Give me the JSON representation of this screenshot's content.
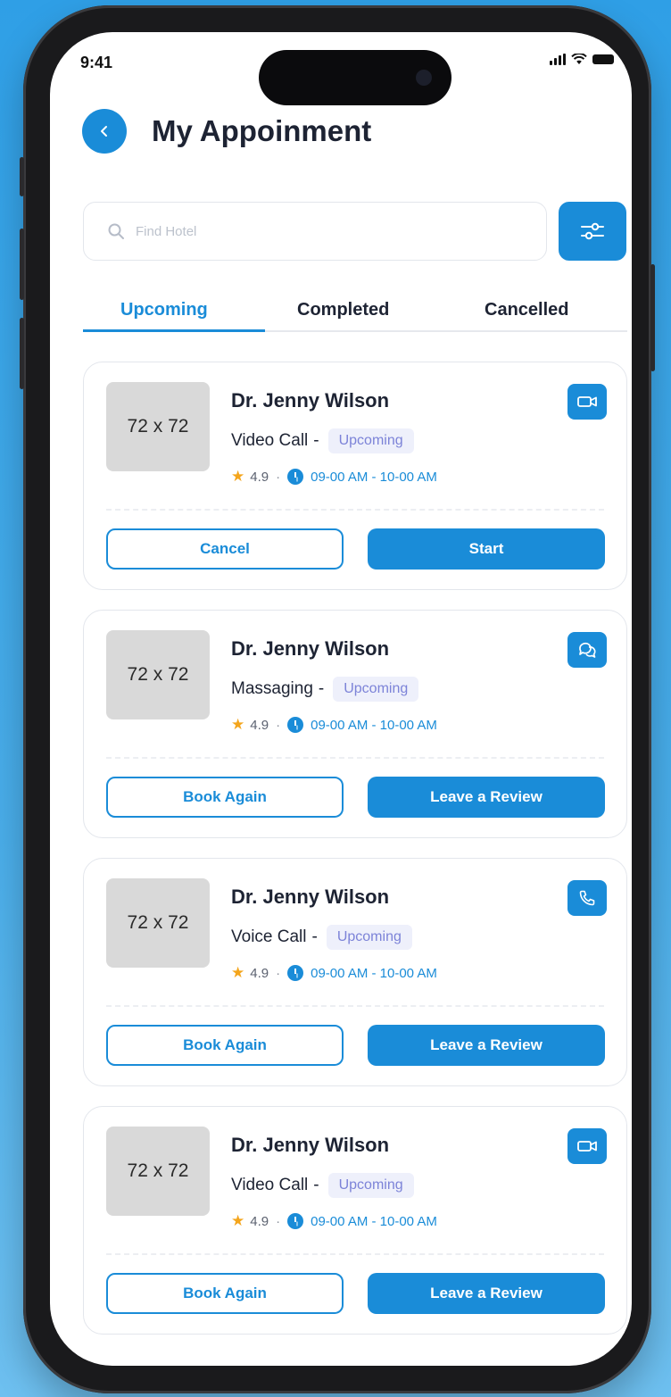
{
  "status_bar": {
    "time": "9:41"
  },
  "header": {
    "title": "My Appoinment"
  },
  "search": {
    "placeholder": "Find Hotel"
  },
  "tabs": [
    {
      "label": "Upcoming",
      "active": true
    },
    {
      "label": "Completed",
      "active": false
    },
    {
      "label": "Cancelled",
      "active": false
    }
  ],
  "appointments": [
    {
      "thumb": "72 x 72",
      "doctor": "Dr. Jenny Wilson",
      "type": "Video Call",
      "separator": "-",
      "status": "Upcoming",
      "rating": "4.9",
      "bullet": "·",
      "time": "09-00 AM - 10-00 AM",
      "mode_icon": "video-icon",
      "secondary_action": "Cancel",
      "primary_action": "Start"
    },
    {
      "thumb": "72 x 72",
      "doctor": "Dr. Jenny Wilson",
      "type": "Massaging",
      "separator": "-",
      "status": "Upcoming",
      "rating": "4.9",
      "bullet": "·",
      "time": "09-00 AM - 10-00 AM",
      "mode_icon": "chat-icon",
      "secondary_action": "Book Again",
      "primary_action": "Leave a Review"
    },
    {
      "thumb": "72 x 72",
      "doctor": "Dr. Jenny Wilson",
      "type": "Voice Call",
      "separator": "-",
      "status": "Upcoming",
      "rating": "4.9",
      "bullet": "·",
      "time": "09-00 AM - 10-00 AM",
      "mode_icon": "phone-icon",
      "secondary_action": "Book Again",
      "primary_action": "Leave a Review"
    },
    {
      "thumb": "72 x 72",
      "doctor": "Dr. Jenny Wilson",
      "type": "Video Call",
      "separator": "-",
      "status": "Upcoming",
      "rating": "4.9",
      "bullet": "·",
      "time": "09-00 AM - 10-00 AM",
      "mode_icon": "video-icon",
      "secondary_action": "Book Again",
      "primary_action": "Leave a Review"
    }
  ],
  "colors": {
    "accent": "#1a8cd8",
    "badge_bg": "#eef0fb",
    "badge_text": "#7c83d8",
    "star": "#f4a51c"
  }
}
